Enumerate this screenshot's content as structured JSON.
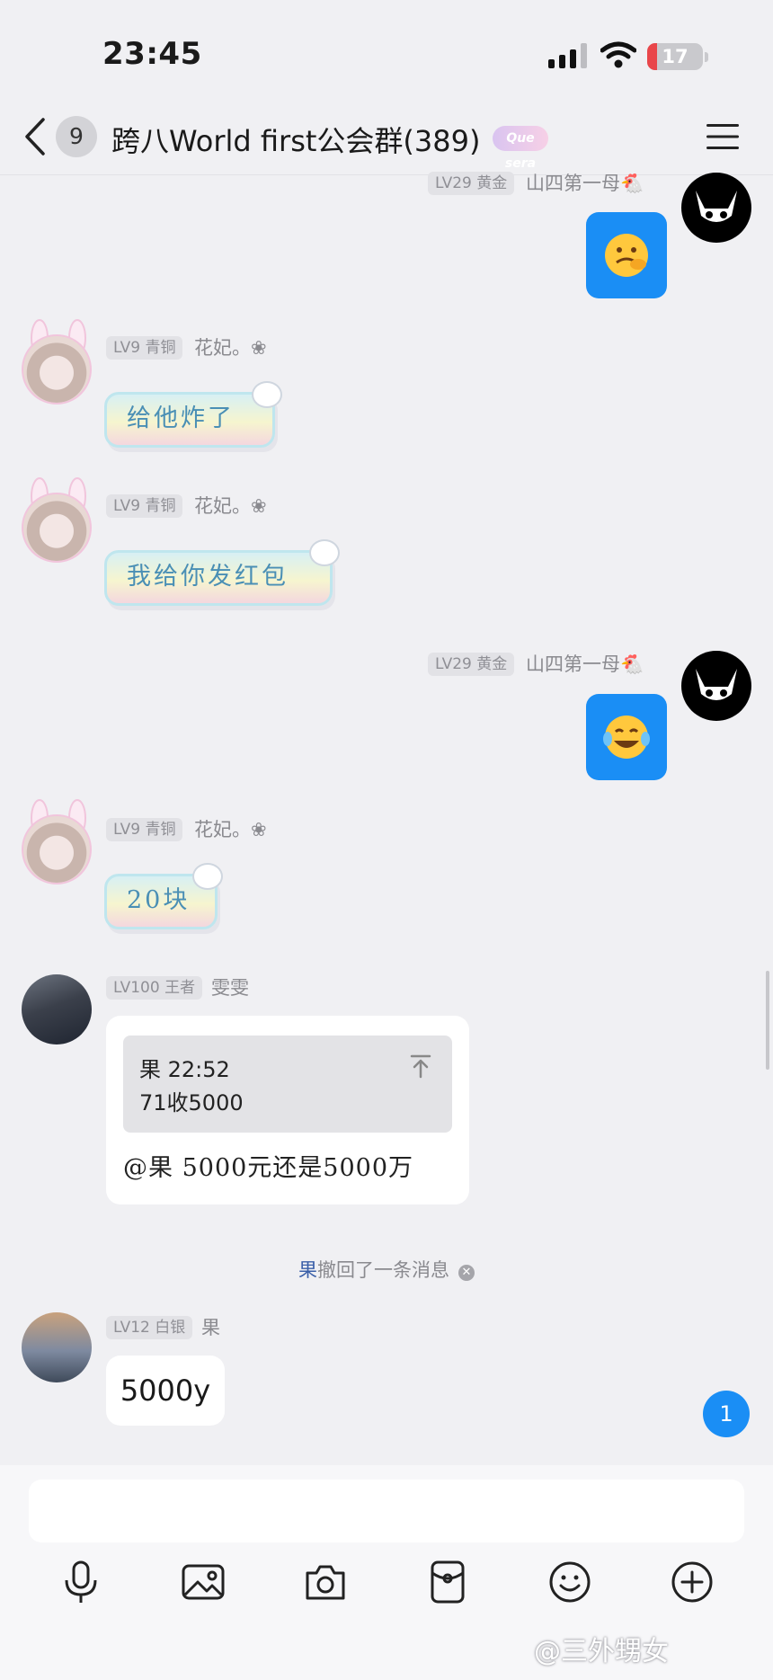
{
  "status_bar": {
    "time": "23:45",
    "battery": "17",
    "battery_level": 0.17
  },
  "header": {
    "unread_count": "9",
    "title": "跨八World first公会群(389)",
    "title_sticker": "Que sera"
  },
  "messages": {
    "m1": {
      "level": "LV29 黄金",
      "nick": "山四第一母🐔"
    },
    "m2": {
      "level": "LV9 青铜",
      "nick": "花妃。❀",
      "sticker_text": "给他炸了"
    },
    "m3": {
      "level": "LV9 青铜",
      "nick": "花妃。❀",
      "sticker_text": "我给你发红包"
    },
    "m4": {
      "level": "LV29 黄金",
      "nick": "山四第一母🐔"
    },
    "m5": {
      "level": "LV9 青铜",
      "nick": "花妃。❀",
      "sticker_text": "20块"
    },
    "m6": {
      "level": "LV100 王者",
      "nick": "雯雯",
      "quote_head": "果 22:52",
      "quote_body": "71收5000",
      "text": "@果 5000元还是5000万"
    },
    "recall": {
      "name": "果",
      "text": "撤回了一条消息"
    },
    "m7": {
      "level": "LV12 白银",
      "nick": "果",
      "text": "5000y"
    }
  },
  "unread_new": "1",
  "input": {
    "value": "",
    "placeholder": ""
  },
  "toolbar": [
    "microphone-icon",
    "image-icon",
    "camera-icon",
    "red-packet-icon",
    "emoji-icon",
    "plus-icon"
  ],
  "watermark": "@三外甥女",
  "colors": {
    "accent": "#1a8ef5",
    "battery_low": "#e9464a"
  }
}
